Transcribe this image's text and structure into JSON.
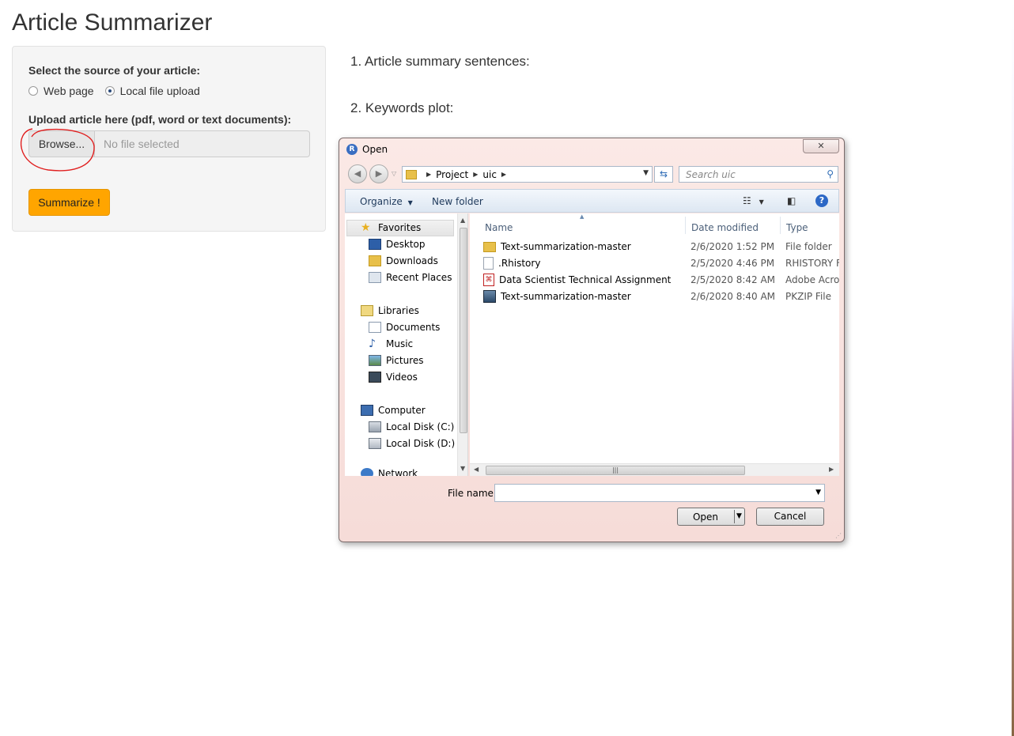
{
  "app": {
    "title": "Article Summarizer"
  },
  "sidebar": {
    "source_label": "Select the source of your article:",
    "radio_options": [
      {
        "label": "Web page",
        "selected": false
      },
      {
        "label": "Local file upload",
        "selected": true
      }
    ],
    "upload_label": "Upload article here (pdf, word or text documents):",
    "browse_label": "Browse...",
    "file_placeholder": "No file selected",
    "summarize_label": "Summarize !"
  },
  "main": {
    "section1": "1. Article summary sentences:",
    "section2": "2. Keywords plot:"
  },
  "dialog": {
    "title": "Open",
    "close_label": "✕",
    "breadcrumb": [
      "Project",
      "uic"
    ],
    "search_placeholder": "Search uic",
    "toolbar": {
      "organize_label": "Organize",
      "new_folder_label": "New folder"
    },
    "nav": {
      "favorites": {
        "label": "Favorites",
        "items": [
          "Desktop",
          "Downloads",
          "Recent Places"
        ]
      },
      "libraries": {
        "label": "Libraries",
        "items": [
          "Documents",
          "Music",
          "Pictures",
          "Videos"
        ]
      },
      "computer": {
        "label": "Computer",
        "items": [
          "Local Disk (C:)",
          "Local Disk (D:)"
        ]
      },
      "network": {
        "label": "Network"
      }
    },
    "columns": [
      "Name",
      "Date modified",
      "Type"
    ],
    "files": [
      {
        "name": "Text-summarization-master",
        "date": "2/6/2020 1:52 PM",
        "type": "File folder",
        "icon": "folder-icon"
      },
      {
        "name": ".Rhistory",
        "date": "2/5/2020 4:46 PM",
        "type": "RHISTORY Fi",
        "icon": "file-icon"
      },
      {
        "name": "Data Scientist Technical Assignment",
        "date": "2/5/2020 8:42 AM",
        "type": "Adobe Acrol",
        "icon": "pdf-icon"
      },
      {
        "name": "Text-summarization-master",
        "date": "2/6/2020 8:40 AM",
        "type": "PKZIP File",
        "icon": "zip-icon"
      }
    ],
    "file_name_label": "File name:",
    "file_name_value": "",
    "open_label": "Open",
    "cancel_label": "Cancel"
  },
  "colors": {
    "summarize_button": "#ffa500",
    "annotation": "#e02020",
    "dialog_frame": "#f6dcd8"
  }
}
